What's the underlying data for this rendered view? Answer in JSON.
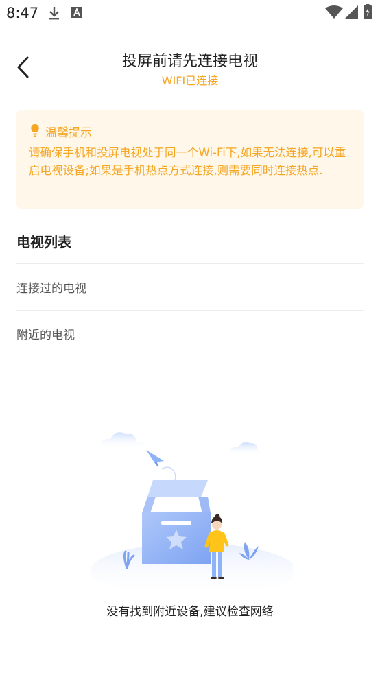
{
  "status_bar": {
    "time": "8:47"
  },
  "header": {
    "title": "投屏前请先连接电视",
    "subtitle": "WIFI已连接",
    "back_icon": "chevron-left-icon"
  },
  "tip": {
    "icon": "lightbulb-icon",
    "title": "温馨提示",
    "body": "请确保手机和投屏电视处于同一个Wi-Fi下,如果无法连接,可以重启电视设备;如果是手机热点方式连接,则需要同时连接热点."
  },
  "tv_list": {
    "title": "电视列表",
    "sections": [
      {
        "label": "连接过的电视"
      },
      {
        "label": "附近的电视"
      }
    ]
  },
  "empty_state": {
    "message": "没有找到附近设备,建议检查网络"
  },
  "colors": {
    "accent": "#F5A623",
    "tip_bg": "#FFF7E9",
    "illustration_blue": "#8FB3F7"
  }
}
